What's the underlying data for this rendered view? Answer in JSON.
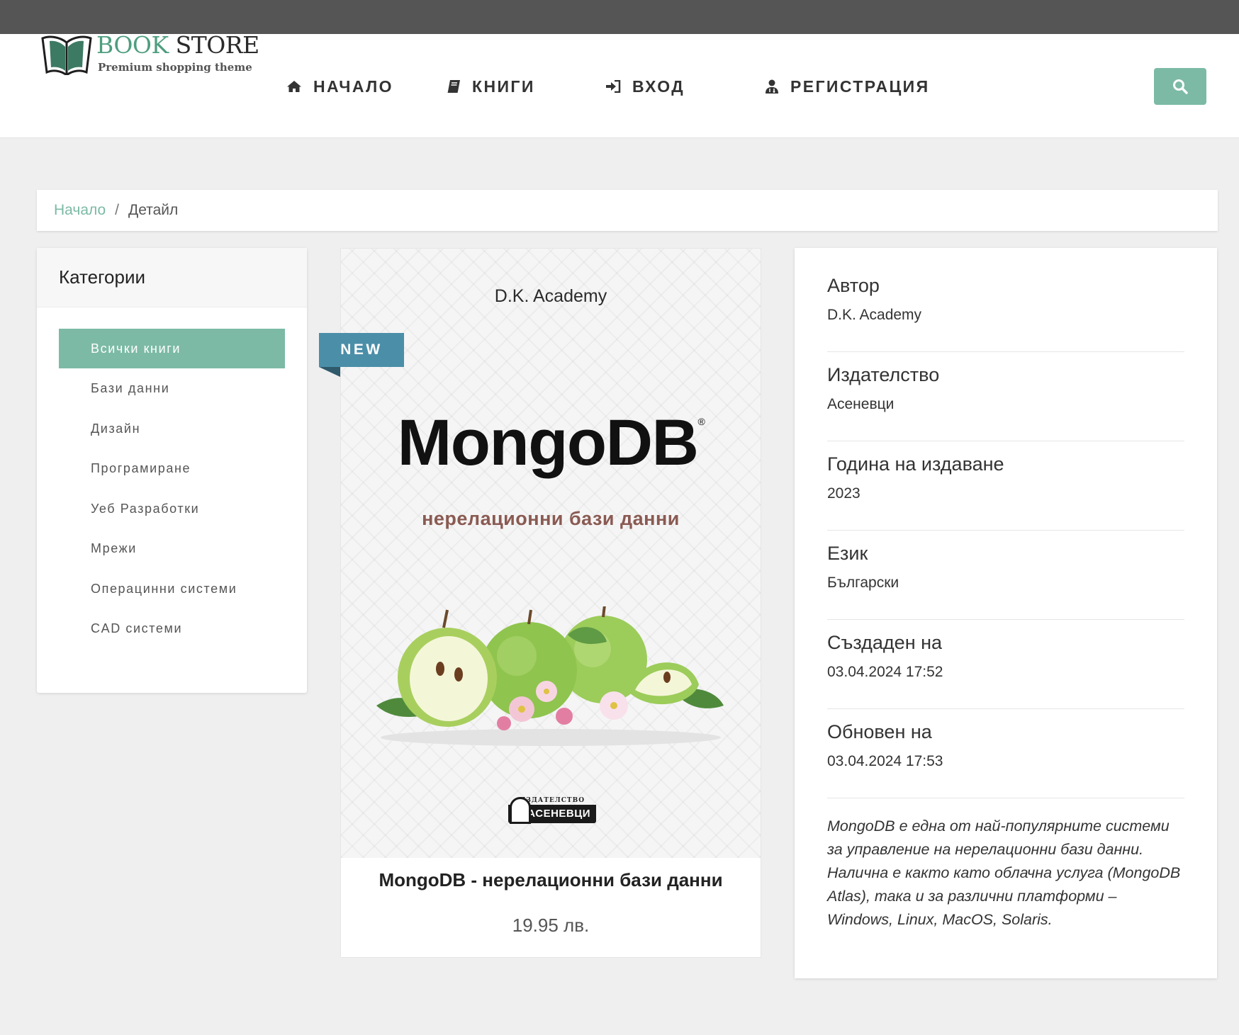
{
  "header": {
    "logo_word1": "BOOK",
    "logo_word2": "STORE",
    "logo_tagline": "Premium shopping theme",
    "nav": [
      {
        "label": "НАЧАЛО",
        "icon": "home-icon"
      },
      {
        "label": "КНИГИ",
        "icon": "book-icon"
      },
      {
        "label": "ВХОД",
        "icon": "sign-in-icon"
      },
      {
        "label": "РЕГИСТРАЦИЯ",
        "icon": "user-doctor-icon"
      }
    ],
    "search_icon": "search-icon"
  },
  "breadcrumb": {
    "home": "Начало",
    "separator": "/",
    "current": "Детайл"
  },
  "categories": {
    "title": "Категории",
    "items": [
      {
        "label": "Всички книги",
        "active": true
      },
      {
        "label": "Бази данни",
        "active": false
      },
      {
        "label": "Дизайн",
        "active": false
      },
      {
        "label": "Програмиране",
        "active": false
      },
      {
        "label": "Уеб Разработки",
        "active": false
      },
      {
        "label": "Мрежи",
        "active": false
      },
      {
        "label": "Операцинни системи",
        "active": false
      },
      {
        "label": "CAD системи",
        "active": false
      }
    ]
  },
  "product": {
    "badge": "NEW",
    "cover": {
      "author": "D.K. Academy",
      "title": "MongoDB",
      "registered_mark": "®",
      "subtitle": "нерелационни бази данни",
      "publisher_top": "ИЗДАТЕЛСТВО",
      "publisher": "АСЕНЕВЦИ"
    },
    "name": "MongoDB - нерелационни бази данни",
    "price": "19.95 лв."
  },
  "details": {
    "rows": [
      {
        "label": "Автор",
        "value": "D.K. Academy"
      },
      {
        "label": "Издателство",
        "value": "Асеневци"
      },
      {
        "label": "Година на издаване",
        "value": "2023"
      },
      {
        "label": "Език",
        "value": "Български"
      },
      {
        "label": "Създаден на",
        "value": "03.04.2024 17:52"
      },
      {
        "label": "Обновен на",
        "value": "03.04.2024 17:53"
      }
    ],
    "description": "MongoDB е една от най-популярните системи за управление на нерелационни бази данни. Налична е както като облачна услуга (MongoDB Atlas), така и за различни платформи – Windows, Linux, MacOS, Solaris."
  },
  "colors": {
    "accent": "#7cbaa5",
    "badge": "#4b8ea8",
    "topbar": "#555555",
    "background": "#efefef"
  }
}
